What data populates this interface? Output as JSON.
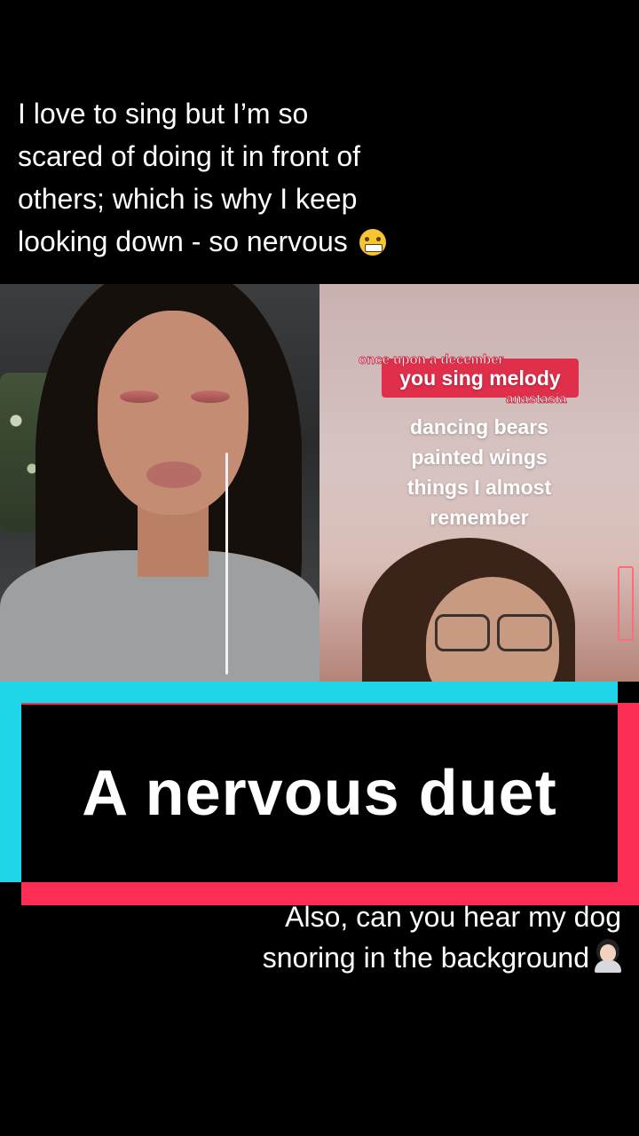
{
  "top_caption": {
    "line1": "I love to sing but I’m so",
    "line2": "scared of doing it in front of",
    "line3": "others; which is why I keep",
    "line4": "looking down - so nervous",
    "emoji": "grimacing-face-emoji"
  },
  "duet": {
    "left_panel": {
      "description_icon": "singer-with-earphones"
    },
    "right_panel": {
      "lyric_small_top": "once upon a december",
      "lyric_pill": "you sing melody",
      "lyric_small_bottom": "anastasia",
      "lyric_lines": [
        "dancing bears",
        "painted wings",
        "things I almost",
        "remember"
      ]
    }
  },
  "banner": {
    "title": "A nervous duet",
    "accent_cyan": "#1ed6e8",
    "accent_red": "#fb2d55"
  },
  "bottom_caption": {
    "line1": "Also, can you hear my dog",
    "line2": "snoring in the background",
    "emoji": "person-facepalming-emoji"
  }
}
